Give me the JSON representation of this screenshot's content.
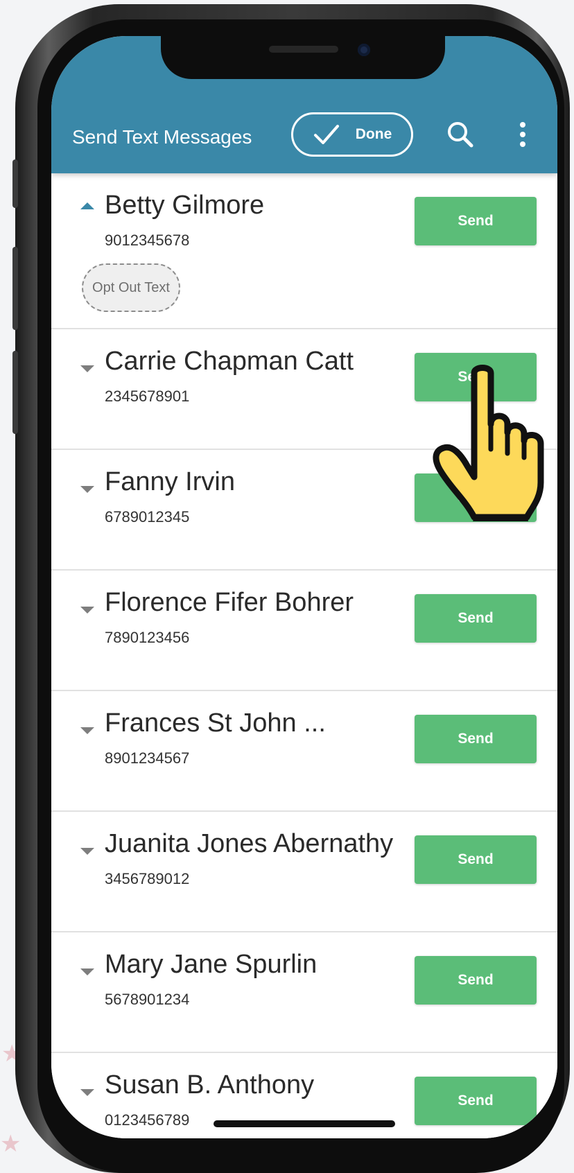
{
  "app_bar": {
    "title": "Send Text Messages",
    "done_label": "Done",
    "search_icon": "search-icon",
    "more_icon": "more-vertical-icon"
  },
  "colors": {
    "app_bar": "#3a88a8",
    "send_button": "#5bbd78",
    "hand_fill": "#fdd95a"
  },
  "contacts": [
    {
      "name": "Betty Gilmore",
      "phone": "9012345678",
      "expanded": true,
      "opt_out_label": "Opt Out Text",
      "send_label": "Send"
    },
    {
      "name": "Carrie Chapman Catt",
      "phone": "2345678901",
      "expanded": false,
      "send_label": "Send"
    },
    {
      "name": "Fanny Irvin",
      "phone": "6789012345",
      "expanded": false,
      "send_label": "Send"
    },
    {
      "name": "Florence Fifer Bohrer",
      "phone": "7890123456",
      "expanded": false,
      "send_label": "Send"
    },
    {
      "name": "Frances St John ...",
      "phone": "8901234567",
      "expanded": false,
      "send_label": "Send"
    },
    {
      "name": "Juanita Jones Abernathy",
      "phone": "3456789012",
      "expanded": false,
      "send_label": "Send"
    },
    {
      "name": "Mary Jane Spurlin",
      "phone": "5678901234",
      "expanded": false,
      "send_label": "Send"
    },
    {
      "name": "Susan B. Anthony",
      "phone": "0123456789",
      "expanded": false,
      "send_label": "Send"
    }
  ],
  "pointer": {
    "icon": "hand-pointer-icon"
  }
}
